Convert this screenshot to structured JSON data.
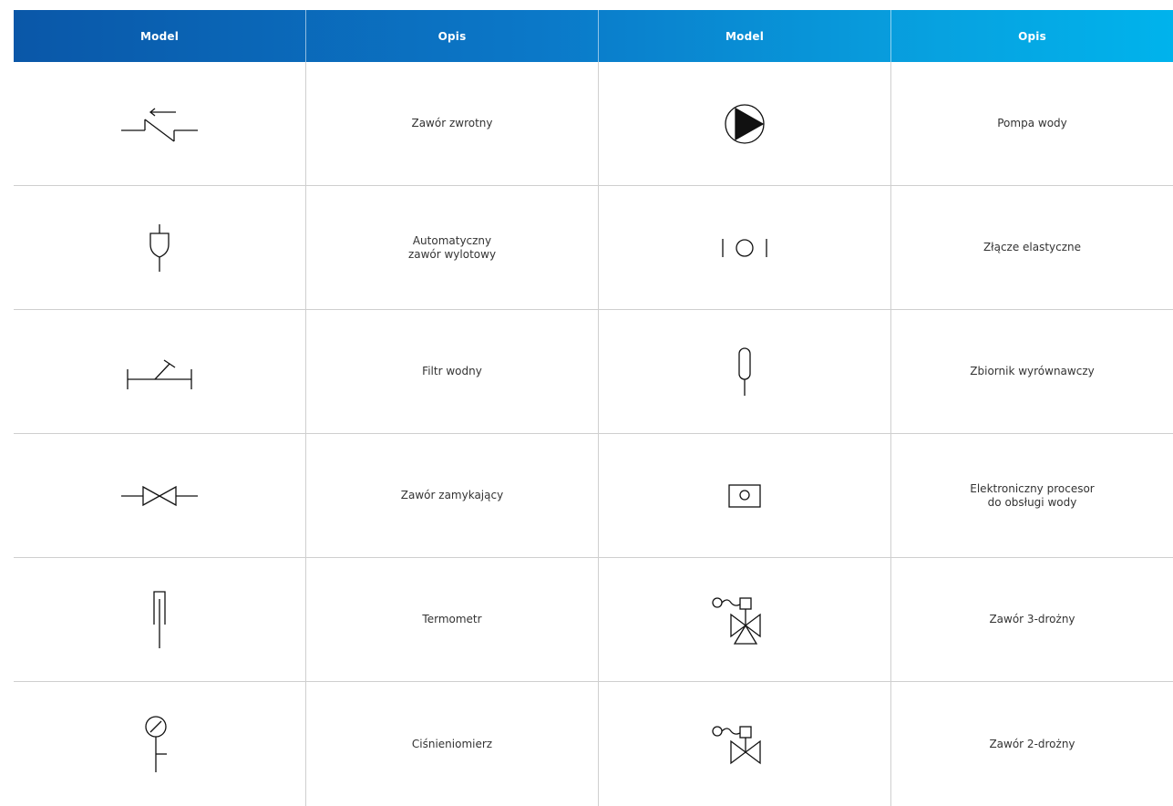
{
  "table": {
    "headers": [
      "Model",
      "Opis",
      "Model",
      "Opis"
    ],
    "rows": [
      {
        "left_icon": "check-valve-icon",
        "left_desc": "Zawór zwrotny",
        "right_icon": "water-pump-icon",
        "right_desc": "Pompa wody"
      },
      {
        "left_icon": "automatic-air-vent-icon",
        "left_desc": "Automatyczny\nzawór wylotowy",
        "right_icon": "flexible-joint-icon",
        "right_desc": "Złącze elastyczne"
      },
      {
        "left_icon": "water-filter-icon",
        "left_desc": "Filtr wodny",
        "right_icon": "expansion-tank-icon",
        "right_desc": "Zbiornik wyrównawczy"
      },
      {
        "left_icon": "shutoff-valve-icon",
        "left_desc": "Zawór zamykający",
        "right_icon": "electronic-processor-icon",
        "right_desc": "Elektroniczny procesor\ndo obsługi wody"
      },
      {
        "left_icon": "thermometer-icon",
        "left_desc": "Termometr",
        "right_icon": "three-way-valve-icon",
        "right_desc": "Zawór 3-drożny"
      },
      {
        "left_icon": "pressure-gauge-icon",
        "left_desc": "Ciśnieniomierz",
        "right_icon": "two-way-valve-icon",
        "right_desc": "Zawór 2-drożny"
      }
    ]
  },
  "colors": {
    "header_start": "#0a57a8",
    "header_end": "#00b3ec",
    "grid": "#cfcfcf"
  }
}
